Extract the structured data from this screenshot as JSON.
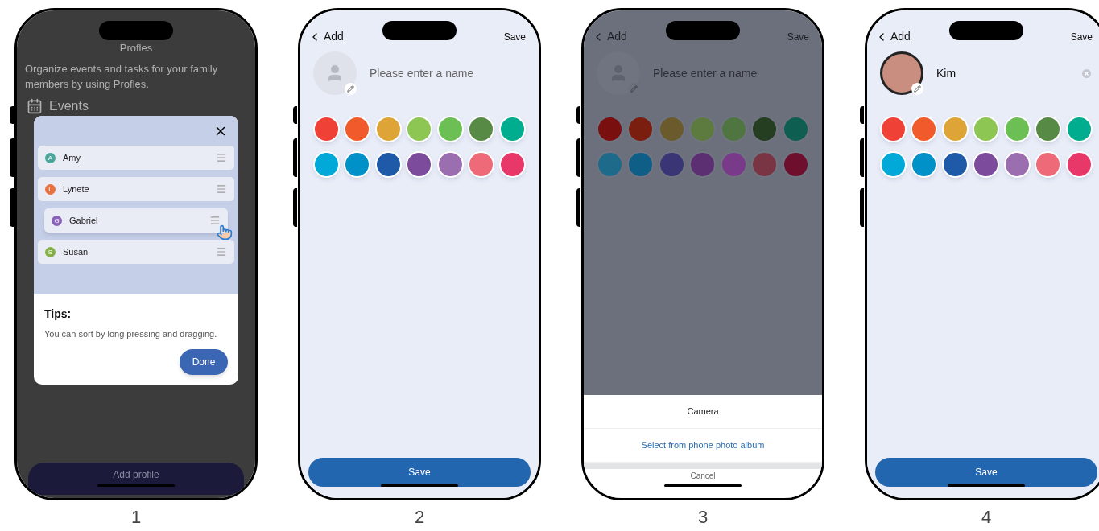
{
  "screens": [
    {
      "kind": "profiles",
      "caption": "1",
      "title": "Profles",
      "intro": "Organize events and tasks for your family members by using Profles.",
      "sections": [
        "Events"
      ],
      "dialog": {
        "members": [
          {
            "initial": "A",
            "name": "Amy",
            "color": "#4aa59a",
            "dragging": false
          },
          {
            "initial": "L",
            "name": "Lynete",
            "color": "#e8703f",
            "dragging": false
          },
          {
            "initial": "G",
            "name": "Gabriel",
            "color": "#8a63b8",
            "dragging": true
          },
          {
            "initial": "S",
            "name": "Susan",
            "color": "#86b04a",
            "dragging": false
          }
        ],
        "tips_title": "Tips:",
        "tips_text": "You can sort by long pressing and dragging.",
        "done": "Done"
      },
      "add_button": "Add profile"
    },
    {
      "kind": "editor",
      "caption": "2",
      "dimmed": false,
      "back": "Add",
      "save": "Save",
      "has_photo": false,
      "name_field": {
        "placeholder": "Please enter a name"
      },
      "colors": [
        {
          "color": "#ef4136"
        },
        {
          "color": "#f15a2b"
        },
        {
          "color": "#dfa437"
        },
        {
          "color": "#8dc653"
        },
        {
          "color": "#6cbf55"
        },
        {
          "color": "#578a44"
        },
        {
          "color": "#00ad8e"
        },
        {
          "color": "#00a9d8"
        },
        {
          "color": "#0091c9"
        },
        {
          "color": "#1e5aa8"
        },
        {
          "color": "#7c4b9c"
        },
        {
          "color": "#9b6eb0"
        },
        {
          "color": "#ef6a78"
        },
        {
          "color": "#e8386a"
        }
      ],
      "save_button": "Save"
    },
    {
      "kind": "editor",
      "caption": "3",
      "dimmed": true,
      "back": "Add",
      "save": "Save",
      "has_photo": false,
      "name_field": {
        "placeholder": "Please enter a name"
      },
      "colors": [
        {
          "color": "#7a0f0f"
        },
        {
          "color": "#7a1f10"
        },
        {
          "color": "#6b5a2c"
        },
        {
          "color": "#5d7a3f"
        },
        {
          "color": "#4f7540"
        },
        {
          "color": "#253e22"
        },
        {
          "color": "#0e5f52"
        },
        {
          "color": "#1e6a8a"
        },
        {
          "color": "#0f5e88"
        },
        {
          "color": "#3a3575"
        },
        {
          "color": "#5c2f73"
        },
        {
          "color": "#7a3a8a"
        },
        {
          "color": "#7a3545"
        },
        {
          "color": "#6e0f2e"
        }
      ],
      "sheet": {
        "options": [
          "Camera",
          "Select from phone photo album"
        ],
        "cancel": "Cancel"
      }
    },
    {
      "kind": "editor",
      "caption": "4",
      "dimmed": false,
      "back": "Add",
      "save": "Save",
      "has_photo": true,
      "name_field": {
        "value": "Kim"
      },
      "colors": [
        {
          "color": "#ef4136"
        },
        {
          "color": "#f15a2b"
        },
        {
          "color": "#dfa437"
        },
        {
          "color": "#8dc653"
        },
        {
          "color": "#6cbf55"
        },
        {
          "color": "#578a44"
        },
        {
          "color": "#00ad8e"
        },
        {
          "color": "#00a9d8"
        },
        {
          "color": "#0091c9"
        },
        {
          "color": "#1e5aa8"
        },
        {
          "color": "#7c4b9c"
        },
        {
          "color": "#9b6eb0"
        },
        {
          "color": "#ef6a78"
        },
        {
          "color": "#e8386a"
        }
      ],
      "save_button": "Save"
    }
  ]
}
